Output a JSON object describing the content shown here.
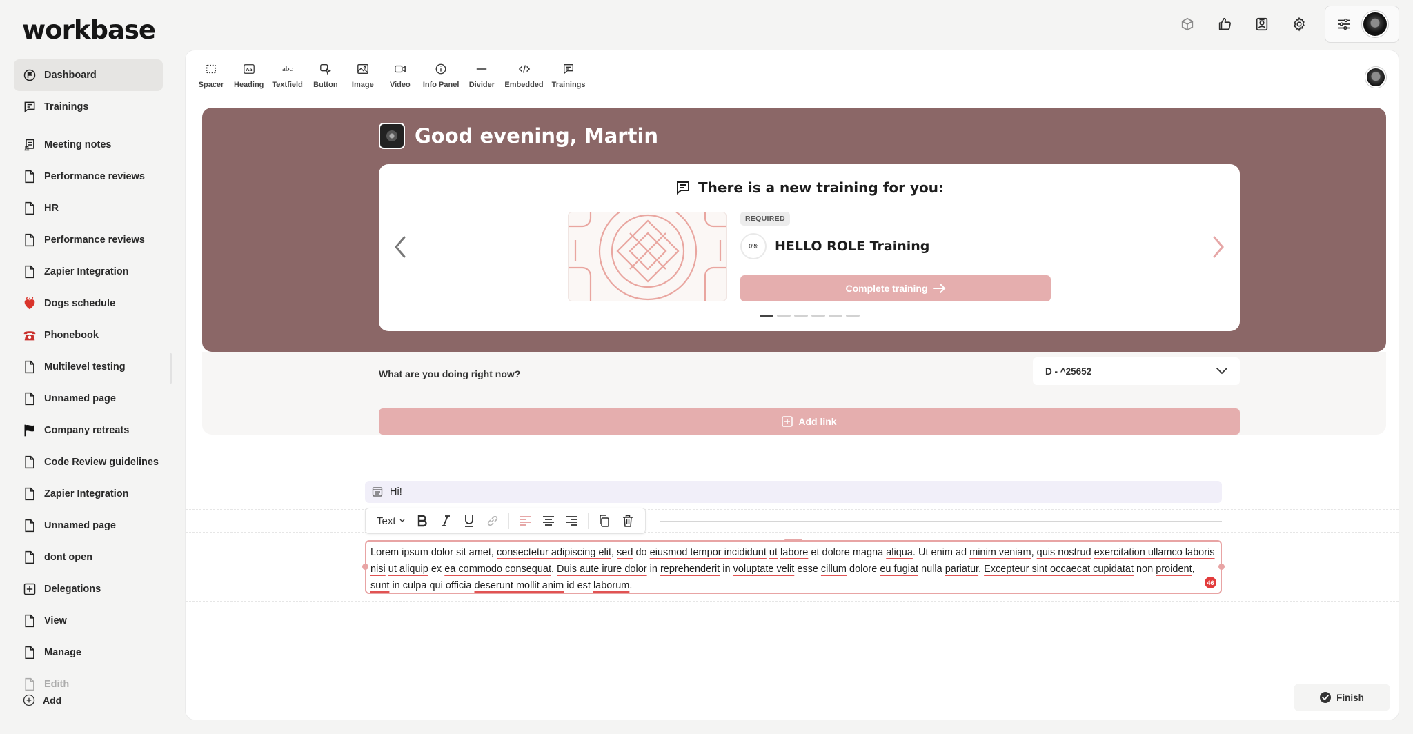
{
  "app": {
    "logo_text": "workbase"
  },
  "topbar": {
    "icons": [
      "cube-icon",
      "thumbs-up-icon",
      "contact-card-icon",
      "gear-icon"
    ],
    "menu_icon": "sliders-icon"
  },
  "sidebar": {
    "primary": [
      {
        "label": "Dashboard",
        "icon": "flag-circle-icon",
        "active": true
      },
      {
        "label": "Trainings",
        "icon": "chat-icon"
      }
    ],
    "pages": [
      {
        "label": "Meeting notes",
        "icon": "notes-icon"
      },
      {
        "label": "Performance reviews",
        "icon": "page-icon"
      },
      {
        "label": "HR",
        "icon": "page-icon"
      },
      {
        "label": "Performance reviews",
        "icon": "page-icon"
      },
      {
        "label": "Zapier Integration",
        "icon": "page-icon"
      },
      {
        "label": "Dogs schedule",
        "icon": "heart-emoji-icon"
      },
      {
        "label": "Phonebook",
        "icon": "telephone-emoji-icon"
      },
      {
        "label": "Multilevel testing",
        "icon": "page-icon"
      },
      {
        "label": "Unnamed page",
        "icon": "page-icon"
      },
      {
        "label": "Company retreats",
        "icon": "black-flag-icon"
      },
      {
        "label": "Code Review guidelines",
        "icon": "page-icon"
      },
      {
        "label": "Zapier Integration",
        "icon": "page-icon"
      },
      {
        "label": "Unnamed page",
        "icon": "page-icon"
      },
      {
        "label": "dont open",
        "icon": "page-icon"
      },
      {
        "label": "Delegations",
        "icon": "plus-square-icon"
      },
      {
        "label": "View",
        "icon": "page-icon"
      },
      {
        "label": "Manage",
        "icon": "page-icon"
      },
      {
        "label": "Edith",
        "icon": "page-icon"
      }
    ],
    "add_label": "Add"
  },
  "toolbar": {
    "tools": [
      {
        "label": "Spacer",
        "icon": "spacer-icon"
      },
      {
        "label": "Heading",
        "icon": "heading-icon"
      },
      {
        "label": "Textfield",
        "icon": "textfield-icon"
      },
      {
        "label": "Button",
        "icon": "button-icon"
      },
      {
        "label": "Image",
        "icon": "image-icon"
      },
      {
        "label": "Video",
        "icon": "video-icon"
      },
      {
        "label": "Info Panel",
        "icon": "info-icon"
      },
      {
        "label": "Divider",
        "icon": "divider-icon"
      },
      {
        "label": "Embedded",
        "icon": "code-icon"
      },
      {
        "label": "Trainings",
        "icon": "chat-icon"
      }
    ],
    "textfield_glyph": "abc"
  },
  "hero": {
    "greeting": "Good evening, Martin",
    "background": "#8b6767",
    "card": {
      "heading": "There is a new training for you:",
      "badge": "REQUIRED",
      "progress": "0%",
      "training_name": "HELLO ROLE Training",
      "button_label": "Complete training",
      "dots_total": 6,
      "dots_active": 0
    }
  },
  "status": {
    "question": "What are you doing right now?",
    "selected": "D - ^25652",
    "add_link_label": "Add link"
  },
  "editor": {
    "hi_text": "Hi!",
    "text_type": "Text",
    "error_count": "46",
    "paragraph": [
      {
        "t": "Lorem ipsum dolor sit amet, ",
        "u": false
      },
      {
        "t": "consectetur adipiscing elit",
        "u": true
      },
      {
        "t": ", ",
        "u": false
      },
      {
        "t": "sed",
        "u": true
      },
      {
        "t": " do ",
        "u": false
      },
      {
        "t": "eiusmod tempor incididunt",
        "u": true
      },
      {
        "t": " ",
        "u": false
      },
      {
        "t": "ut",
        "u": true
      },
      {
        "t": " ",
        "u": false
      },
      {
        "t": "labore",
        "u": true
      },
      {
        "t": " et dolore magna ",
        "u": false
      },
      {
        "t": "aliqua",
        "u": true
      },
      {
        "t": ". Ut enim ad ",
        "u": false
      },
      {
        "t": "minim veniam",
        "u": true
      },
      {
        "t": ", ",
        "u": false
      },
      {
        "t": "quis nostrud",
        "u": true
      },
      {
        "t": " ",
        "u": false
      },
      {
        "t": "exercitation ullamco laboris nisi",
        "u": true
      },
      {
        "t": " ",
        "u": false
      },
      {
        "t": "ut aliquip",
        "u": true
      },
      {
        "t": " ex ",
        "u": false
      },
      {
        "t": "ea commodo consequat",
        "u": true
      },
      {
        "t": ". ",
        "u": false
      },
      {
        "t": "Duis aute irure dolor",
        "u": true
      },
      {
        "t": " in ",
        "u": false
      },
      {
        "t": "reprehenderit",
        "u": true
      },
      {
        "t": " in ",
        "u": false
      },
      {
        "t": "voluptate velit",
        "u": true
      },
      {
        "t": " esse ",
        "u": false
      },
      {
        "t": "cillum",
        "u": true
      },
      {
        "t": " dolore ",
        "u": false
      },
      {
        "t": "eu fugiat",
        "u": true
      },
      {
        "t": " nulla ",
        "u": false
      },
      {
        "t": "pariatur",
        "u": true
      },
      {
        "t": ". ",
        "u": false
      },
      {
        "t": "Excepteur sint occaecat cupidatat",
        "u": true
      },
      {
        "t": " non ",
        "u": false
      },
      {
        "t": "proident",
        "u": true
      },
      {
        "t": ", ",
        "u": false
      },
      {
        "t": "sunt",
        "u": true
      },
      {
        "t": " in culpa qui officia ",
        "u": false
      },
      {
        "t": "deserunt mollit anim",
        "u": true
      },
      {
        "t": " id est ",
        "u": false
      },
      {
        "t": "laborum",
        "u": true
      },
      {
        "t": ".",
        "u": false
      }
    ]
  },
  "footer": {
    "finish_label": "Finish"
  },
  "colors": {
    "accent": "#e5aeae",
    "hero": "#8b6767",
    "spell_error": "#e15353"
  }
}
